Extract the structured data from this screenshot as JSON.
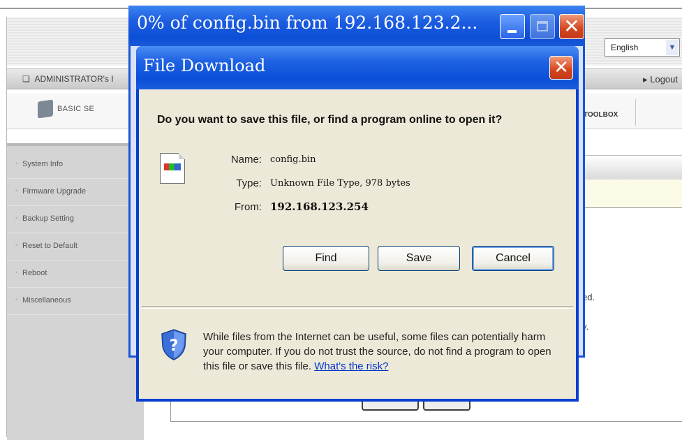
{
  "background": {
    "language_select": {
      "value": "English"
    },
    "admin_header": {
      "title": "ADMINISTRATOR's I",
      "logout": "Logout"
    },
    "nav": {
      "basic_label": "BASIC SE",
      "toolbox_label": "TOOLBOX"
    },
    "sidebar": {
      "items": [
        {
          "label": "System Info"
        },
        {
          "label": "Firmware Upgrade"
        },
        {
          "label": "Backup Setting"
        },
        {
          "label": "Reset to Default"
        },
        {
          "label": "Reboot"
        },
        {
          "label": "Miscellaneous"
        }
      ]
    },
    "content": {
      "fragment_1": "ed.",
      "fragment_2": "y."
    }
  },
  "rear_window": {
    "title": "0% of config.bin from 192.168.123.2...",
    "progress_percent": 0
  },
  "dialog": {
    "title": "File Download",
    "question": "Do you want to save this file, or find a program online to open it?",
    "file": {
      "name_label": "Name:",
      "name_value": "config.bin",
      "type_label": "Type:",
      "type_value": "Unknown File Type, 978 bytes",
      "from_label": "From:",
      "from_value": "192.168.123.254"
    },
    "buttons": {
      "find": "Find",
      "save": "Save",
      "cancel": "Cancel"
    },
    "warning": "While files from the Internet can be useful, some files can potentially harm your computer. If you do not trust the source, do not find a program to open this file or save this file.",
    "risk_link": "What's the risk?"
  },
  "colors": {
    "title_bar_blue": "#0b4fd7",
    "dialog_body": "#ece9d8",
    "close_red": "#d3451f",
    "link": "#0033cc"
  },
  "icons": [
    "close-icon",
    "minimize-icon",
    "maximize-icon",
    "file-icon",
    "shield-question-icon",
    "dropdown-arrow-icon"
  ]
}
